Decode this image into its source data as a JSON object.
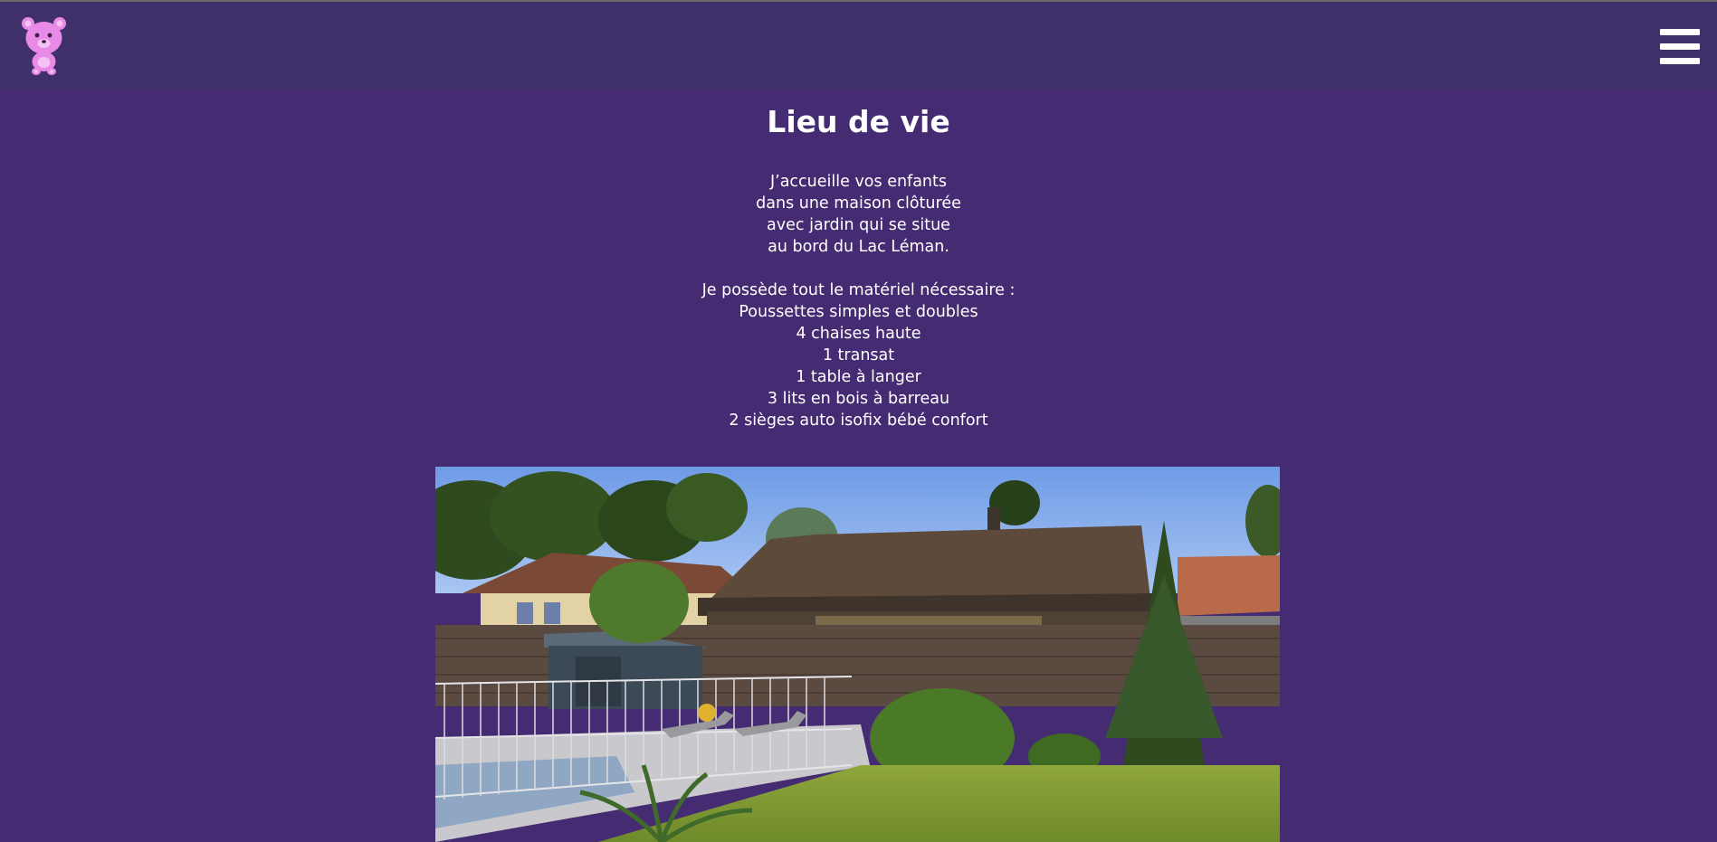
{
  "header": {
    "logo_icon": "teddy-bear-logo-icon",
    "menu_icon": "hamburger-menu-icon"
  },
  "page": {
    "title": "Lieu de vie",
    "intro_lines": [
      "J’accueille vos enfants",
      "dans une maison clôturée",
      "avec jardin qui se situe",
      "au bord du Lac Léman."
    ],
    "equipment_heading": "Je possède tout le matériel nécessaire :",
    "equipment_items": [
      "Poussettes simples et doubles",
      "4 chaises haute",
      "1 transat",
      "1 table à langer",
      "3 lits en bois à barreau",
      "2 sièges auto isofix bébé confort"
    ]
  },
  "colors": {
    "background": "#452c72",
    "header": "#40306a",
    "text": "#ffffff",
    "logo_pink": "#e88ae6"
  }
}
